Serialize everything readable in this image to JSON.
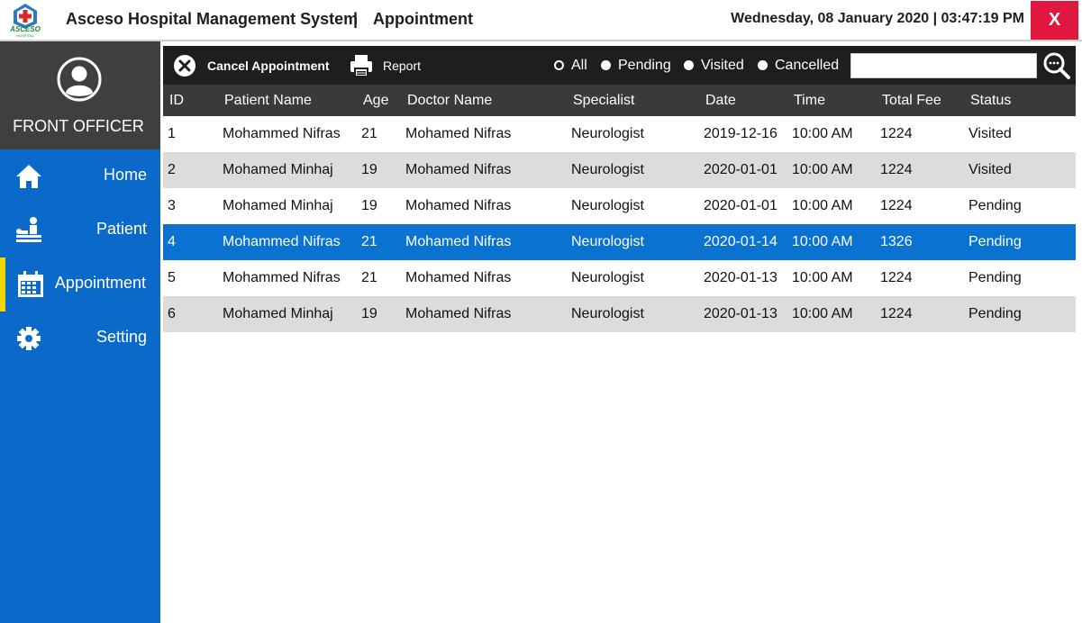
{
  "window": {
    "app_title": "Asceso Hospital Management System",
    "title_separator": "|",
    "page_title": "Appointment",
    "datetime": "Wednesday, 08 January 2020 | 03:47:19 PM",
    "close_label": "X",
    "logo_text": "ASCESO",
    "logo_subtext": "HOSPITAL",
    "logo_icon": "hospital-logo-icon"
  },
  "sidebar": {
    "role": "FRONT OFFICER",
    "avatar_icon": "user-avatar-icon",
    "items": [
      {
        "label": "Home",
        "icon": "home-icon",
        "active": false
      },
      {
        "label": "Patient",
        "icon": "patient-icon",
        "active": false
      },
      {
        "label": "Appointment",
        "icon": "calendar-icon",
        "active": true
      },
      {
        "label": "Setting",
        "icon": "gear-icon",
        "active": false
      }
    ]
  },
  "toolbar": {
    "cancel_label": "Cancel Appointment",
    "report_label": "Report",
    "filters": [
      {
        "label": "All",
        "checked": true
      },
      {
        "label": "Pending",
        "checked": false
      },
      {
        "label": "Visited",
        "checked": false
      },
      {
        "label": "Cancelled",
        "checked": false
      }
    ],
    "search_value": ""
  },
  "table": {
    "columns": [
      "ID",
      "Patient Name",
      "Age",
      "Doctor Name",
      "Specialist",
      "Date",
      "Time",
      "Total Fee",
      "Status"
    ],
    "rows": [
      [
        "1",
        "Mohammed Nifras",
        "21",
        "Mohamed Nifras",
        "Neurologist",
        "2019-12-16",
        "10:00 AM",
        "1224",
        "Visited"
      ],
      [
        "2",
        "Mohamed Minhaj",
        "19",
        "Mohamed Nifras",
        "Neurologist",
        "2020-01-01",
        "10:00 AM",
        "1224",
        "Visited"
      ],
      [
        "3",
        "Mohamed Minhaj",
        "19",
        "Mohamed Nifras",
        "Neurologist",
        "2020-01-01",
        "10:00 AM",
        "1224",
        "Pending"
      ],
      [
        "4",
        "Mohammed Nifras",
        "21",
        "Mohamed Nifras",
        "Neurologist",
        "2020-01-14",
        "10:00 AM",
        "1326",
        "Pending"
      ],
      [
        "5",
        "Mohammed Nifras",
        "21",
        "Mohamed Nifras",
        "Neurologist",
        "2020-01-13",
        "10:00 AM",
        "1224",
        "Pending"
      ],
      [
        "6",
        "Mohamed Minhaj",
        "19",
        "Mohamed Nifras",
        "Neurologist",
        "2020-01-13",
        "10:00 AM",
        "1224",
        "Pending"
      ]
    ],
    "selected_row": 3
  },
  "colors": {
    "sidebar": "#0b6ac9",
    "profile": "#3f3f3f",
    "active_marker": "#f3d400",
    "toolbar": "#1e1e1e",
    "header": "#3a3a3a",
    "row_alt": "#dcdcdc",
    "row_selected": "#0a73d1",
    "close": "#e0173e"
  }
}
